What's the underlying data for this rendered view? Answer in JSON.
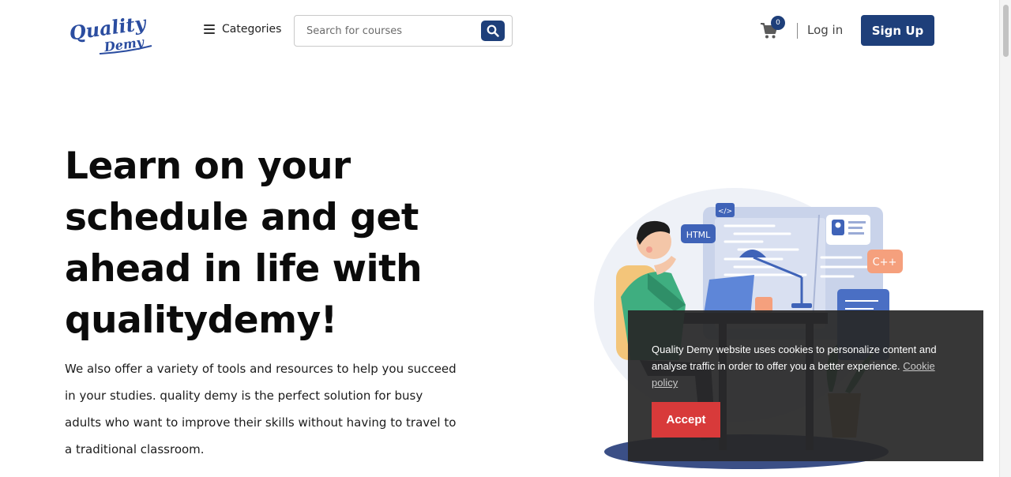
{
  "header": {
    "logo": {
      "line1": "Quality",
      "line2": "Demy",
      "color": "#2b4da0"
    },
    "categories_label": "Categories",
    "search": {
      "placeholder": "Search for courses",
      "value": ""
    },
    "cart_count": "0",
    "login_label": "Log in",
    "signup_label": "Sign Up"
  },
  "hero": {
    "title_lines": [
      "Learn on your",
      "schedule and get",
      "ahead in life with",
      "qualitydemy!"
    ],
    "description": "We also offer a variety of tools and resources to help you succeed in your studies. quality demy is the perfect solution for busy adults who want to improve their skills without having to travel to a traditional classroom.",
    "illustration_labels": {
      "code_tag": "</>",
      "html": "HTML",
      "cpp": "C++"
    }
  },
  "cookie_banner": {
    "message": "Quality Demy website uses cookies to personalize content and analyse traffic in order to offer you a better experience.",
    "link_label": "Cookie policy",
    "accept_label": "Accept"
  },
  "colors": {
    "brand": "#1e3f7a",
    "accept": "#d83a3a",
    "banner_bg": "#282828"
  },
  "icons": {
    "menu": "hamburger-icon",
    "search": "search-icon",
    "cart": "cart-icon"
  }
}
